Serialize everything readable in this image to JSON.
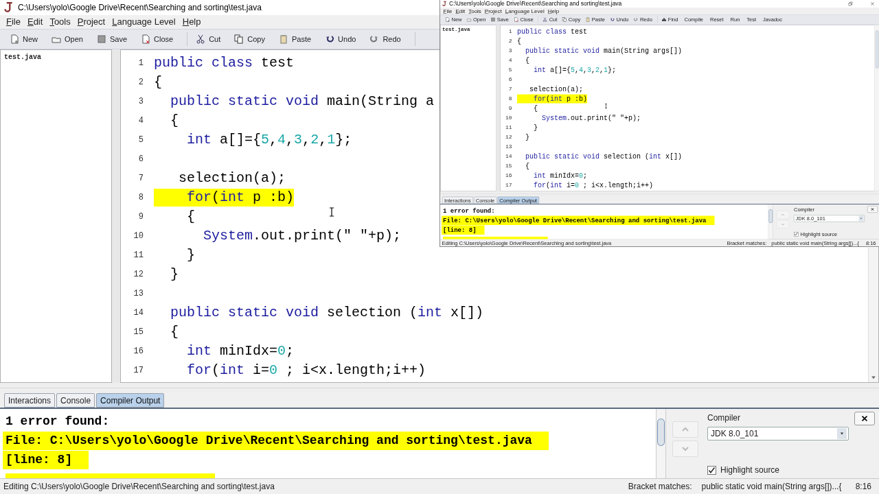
{
  "main_window": {
    "title": "C:\\Users\\yolo\\Google Drive\\Recent\\Searching and sorting\\test.java",
    "menu": [
      "File",
      "Edit",
      "Tools",
      "Project",
      "Language Level",
      "Help"
    ],
    "toolbar": [
      "New",
      "Open",
      "Save",
      "Close",
      "Cut",
      "Copy",
      "Paste",
      "Undo",
      "Redo"
    ],
    "documents": [
      "test.java"
    ],
    "code": [
      {
        "number": "1",
        "highlighted": false,
        "segments": [
          {
            "kind": "keyword",
            "text": "public class"
          },
          {
            "kind": "plain",
            "text": " test"
          }
        ]
      },
      {
        "number": "2",
        "highlighted": false,
        "segments": [
          {
            "kind": "plain",
            "text": "{"
          }
        ]
      },
      {
        "number": "3",
        "highlighted": false,
        "segments": [
          {
            "kind": "keyword",
            "text": "  public static void"
          },
          {
            "kind": "plain",
            "text": " main(String a"
          }
        ]
      },
      {
        "number": "4",
        "highlighted": false,
        "segments": [
          {
            "kind": "plain",
            "text": "  {"
          }
        ]
      },
      {
        "number": "5",
        "highlighted": false,
        "segments": [
          {
            "kind": "keyword",
            "text": "    int"
          },
          {
            "kind": "plain",
            "text": " a[]={"
          },
          {
            "kind": "number",
            "text": "5"
          },
          {
            "kind": "plain",
            "text": ","
          },
          {
            "kind": "number",
            "text": "4"
          },
          {
            "kind": "plain",
            "text": ","
          },
          {
            "kind": "number",
            "text": "3"
          },
          {
            "kind": "plain",
            "text": ","
          },
          {
            "kind": "number",
            "text": "2"
          },
          {
            "kind": "plain",
            "text": ","
          },
          {
            "kind": "number",
            "text": "1"
          },
          {
            "kind": "plain",
            "text": "};"
          }
        ]
      },
      {
        "number": "6"
      },
      {
        "number": "7",
        "highlighted": false,
        "segments": [
          {
            "kind": "plain",
            "text": "   selection(a);"
          }
        ]
      },
      {
        "number": "8",
        "highlighted": true,
        "segments": [
          {
            "kind": "keyword",
            "text": "    for"
          },
          {
            "kind": "plain",
            "text": "("
          },
          {
            "kind": "keyword",
            "text": "int"
          },
          {
            "kind": "plain",
            "text": " p :b)"
          }
        ]
      },
      {
        "number": "9",
        "highlighted": false,
        "segments": [
          {
            "kind": "plain",
            "text": "    {"
          }
        ]
      },
      {
        "number": "10",
        "highlighted": false,
        "segments": [
          {
            "kind": "keyword",
            "text": "      System"
          },
          {
            "kind": "plain",
            "text": ".out.print(\" \"+p);"
          }
        ]
      },
      {
        "number": "11",
        "highlighted": false,
        "segments": [
          {
            "kind": "plain",
            "text": "    }"
          }
        ]
      },
      {
        "number": "12",
        "highlighted": false,
        "segments": [
          {
            "kind": "plain",
            "text": "  }"
          }
        ]
      },
      {
        "number": "13"
      },
      {
        "number": "14",
        "highlighted": false,
        "segments": [
          {
            "kind": "keyword",
            "text": "  public static void"
          },
          {
            "kind": "plain",
            "text": " selection ("
          },
          {
            "kind": "keyword",
            "text": "int"
          },
          {
            "kind": "plain",
            "text": " x[])"
          }
        ]
      },
      {
        "number": "15",
        "highlighted": false,
        "segments": [
          {
            "kind": "plain",
            "text": "  {"
          }
        ]
      },
      {
        "number": "16",
        "highlighted": false,
        "segments": [
          {
            "kind": "keyword",
            "text": "    int"
          },
          {
            "kind": "plain",
            "text": " minIdx="
          },
          {
            "kind": "number",
            "text": "0"
          },
          {
            "kind": "plain",
            "text": ";"
          }
        ]
      },
      {
        "number": "17",
        "highlighted": false,
        "segments": [
          {
            "kind": "keyword",
            "text": "    for"
          },
          {
            "kind": "plain",
            "text": "("
          },
          {
            "kind": "keyword",
            "text": "int"
          },
          {
            "kind": "plain",
            "text": " i="
          },
          {
            "kind": "number",
            "text": "0"
          },
          {
            "kind": "plain",
            "text": " ; i<x.length;i++)"
          }
        ]
      }
    ],
    "bottom_tabs": [
      {
        "label": "Interactions",
        "selected": false
      },
      {
        "label": "Console",
        "selected": false
      },
      {
        "label": "Compiler Output",
        "selected": true
      }
    ],
    "output": [
      {
        "text": "1 error found:",
        "highlighted": false
      },
      {
        "text": "File: C:\\Users\\yolo\\Google Drive\\Recent\\Searching and sorting\\test.java",
        "highlighted": true
      },
      {
        "text": "[line: 8]",
        "highlighted": true
      }
    ],
    "compiler": {
      "label": "Compiler",
      "value": "JDK 8.0_101"
    },
    "highlight_source": {
      "label": "Highlight source",
      "checked": true
    },
    "status": {
      "editing": "Editing C:\\Users\\yolo\\Google Drive\\Recent\\Searching and sorting\\test.java",
      "bracket_label": "Bracket matches:",
      "bracket_value": "public static void main(String args[])...{",
      "position": "8:16"
    }
  },
  "inset_window": {
    "title": "C:\\Users\\yolo\\Google Drive\\Recent\\Searching and sorting\\test.java",
    "menu": [
      "File",
      "Edit",
      "Tools",
      "Project",
      "Language Level",
      "Help"
    ],
    "toolbar": [
      "New",
      "Open",
      "Save",
      "Close",
      "Cut",
      "Copy",
      "Paste",
      "Undo",
      "Redo",
      "Find",
      "Compile",
      "Reset",
      "Run",
      "Test",
      "Javadoc"
    ],
    "documents": [
      "test.java"
    ],
    "code": [
      {
        "number": "1",
        "highlighted": false,
        "segments": [
          {
            "kind": "keyword",
            "text": "public class"
          },
          {
            "kind": "plain",
            "text": " test"
          }
        ]
      },
      {
        "number": "2",
        "highlighted": false,
        "segments": [
          {
            "kind": "plain",
            "text": "{"
          }
        ]
      },
      {
        "number": "3",
        "highlighted": false,
        "segments": [
          {
            "kind": "keyword",
            "text": "  public static void"
          },
          {
            "kind": "plain",
            "text": " main(String args[])"
          }
        ]
      },
      {
        "number": "4",
        "highlighted": false,
        "segments": [
          {
            "kind": "plain",
            "text": "  {"
          }
        ]
      },
      {
        "number": "5",
        "highlighted": false,
        "segments": [
          {
            "kind": "keyword",
            "text": "    int"
          },
          {
            "kind": "plain",
            "text": " a[]={"
          },
          {
            "kind": "number",
            "text": "5"
          },
          {
            "kind": "plain",
            "text": ","
          },
          {
            "kind": "number",
            "text": "4"
          },
          {
            "kind": "plain",
            "text": ","
          },
          {
            "kind": "number",
            "text": "3"
          },
          {
            "kind": "plain",
            "text": ","
          },
          {
            "kind": "number",
            "text": "2"
          },
          {
            "kind": "plain",
            "text": ","
          },
          {
            "kind": "number",
            "text": "1"
          },
          {
            "kind": "plain",
            "text": "};"
          }
        ]
      },
      {
        "number": "6"
      },
      {
        "number": "7",
        "highlighted": false,
        "segments": [
          {
            "kind": "plain",
            "text": "   selection(a);"
          }
        ]
      },
      {
        "number": "8",
        "highlighted": true,
        "segments": [
          {
            "kind": "keyword",
            "text": "    for"
          },
          {
            "kind": "plain",
            "text": "("
          },
          {
            "kind": "keyword",
            "text": "int"
          },
          {
            "kind": "plain",
            "text": " p :b)"
          }
        ]
      },
      {
        "number": "9",
        "highlighted": false,
        "segments": [
          {
            "kind": "plain",
            "text": "    {"
          }
        ]
      },
      {
        "number": "10",
        "highlighted": false,
        "segments": [
          {
            "kind": "keyword",
            "text": "      System"
          },
          {
            "kind": "plain",
            "text": ".out.print(\" \"+p);"
          }
        ]
      },
      {
        "number": "11",
        "highlighted": false,
        "segments": [
          {
            "kind": "plain",
            "text": "    }"
          }
        ]
      },
      {
        "number": "12",
        "highlighted": false,
        "segments": [
          {
            "kind": "plain",
            "text": "  }"
          }
        ]
      },
      {
        "number": "13"
      },
      {
        "number": "14",
        "highlighted": false,
        "segments": [
          {
            "kind": "keyword",
            "text": "  public static void"
          },
          {
            "kind": "plain",
            "text": " selection ("
          },
          {
            "kind": "keyword",
            "text": "int"
          },
          {
            "kind": "plain",
            "text": " x[])"
          }
        ]
      },
      {
        "number": "15",
        "highlighted": false,
        "segments": [
          {
            "kind": "plain",
            "text": "  {"
          }
        ]
      },
      {
        "number": "16",
        "highlighted": false,
        "segments": [
          {
            "kind": "keyword",
            "text": "    int"
          },
          {
            "kind": "plain",
            "text": " minIdx="
          },
          {
            "kind": "number",
            "text": "0"
          },
          {
            "kind": "plain",
            "text": ";"
          }
        ]
      },
      {
        "number": "17",
        "highlighted": false,
        "segments": [
          {
            "kind": "keyword",
            "text": "    for"
          },
          {
            "kind": "plain",
            "text": "("
          },
          {
            "kind": "keyword",
            "text": "int"
          },
          {
            "kind": "plain",
            "text": " i="
          },
          {
            "kind": "number",
            "text": "0"
          },
          {
            "kind": "plain",
            "text": " ; i<x.length;i++)"
          }
        ]
      }
    ],
    "bottom_tabs": [
      {
        "label": "Interactions",
        "selected": false
      },
      {
        "label": "Console",
        "selected": false
      },
      {
        "label": "Compiler Output",
        "selected": true
      }
    ],
    "output": [
      {
        "text": "1 error found:",
        "highlighted": false
      },
      {
        "text": "File: C:\\Users\\yolo\\Google Drive\\Recent\\Searching and sorting\\test.java",
        "highlighted": true
      },
      {
        "text": "[line: 8]",
        "highlighted": true
      }
    ],
    "compiler": {
      "label": "Compiler",
      "value": "JDK 8.0_101"
    },
    "highlight_source": {
      "label": "Highlight source",
      "checked": true
    },
    "status": {
      "editing": "Editing C:\\Users\\yolo\\Google Drive\\Recent\\Searching and sorting\\test.java",
      "bracket_label": "Bracket matches:",
      "bracket_value": "public static void main(String args[])...{",
      "position": "8:16"
    }
  }
}
